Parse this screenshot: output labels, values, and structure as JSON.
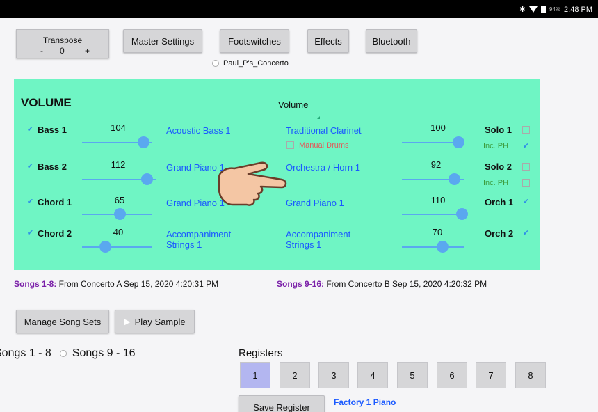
{
  "status_bar": {
    "battery": "94%",
    "time": "2:48 PM"
  },
  "top_buttons": {
    "transpose_label": "Transpose",
    "transpose_minus": "-",
    "transpose_value": "0",
    "transpose_plus": "+",
    "master_settings": "Master Settings",
    "footswitches": "Footswitches",
    "effects": "Effects",
    "bluetooth": "Bluetooth"
  },
  "song_name": "Paul_P's_Concerto",
  "volume_panel": {
    "title": "VOLUME",
    "center_label": "Volume",
    "left_rows": [
      {
        "label": "Bass 1",
        "value": "104",
        "voice": "Acoustic Bass 1",
        "checked": true,
        "level": 0.82
      },
      {
        "label": "Bass 2",
        "value": "112",
        "voice": "Grand Piano 1",
        "checked": true,
        "level": 0.88
      },
      {
        "label": "Chord 1",
        "value": "65",
        "voice": "Grand Piano 1",
        "checked": true,
        "level": 0.51
      },
      {
        "label": "Chord 2",
        "value": "40",
        "voice": "Accompaniment Strings 1",
        "checked": true,
        "level": 0.31
      }
    ],
    "right_rows": [
      {
        "voice": "Traditional Clarinet",
        "value": "100",
        "label": "Solo 1",
        "checked": false,
        "level": 0.79
      },
      {
        "voice": "Orchestra / Horn 1",
        "value": "92",
        "label": "Solo 2",
        "checked": false,
        "level": 0.72
      },
      {
        "voice": "Grand Piano 1",
        "value": "110",
        "label": "Orch 1",
        "checked": true,
        "level": 0.87
      },
      {
        "voice": "Accompaniment Strings 1",
        "value": "70",
        "label": "Orch 2",
        "checked": true,
        "level": 0.55
      }
    ],
    "manual_drums": "Manual Drums",
    "inc_ph": "Inc. PH"
  },
  "songs_info": {
    "set1_label": "Songs 1-8:",
    "set1_text": " From Concerto A Sep 15, 2020 4:20:31 PM",
    "set2_label": "Songs 9-16:",
    "set2_text": " From Concerto B Sep 15, 2020 4:20:32 PM"
  },
  "actions": {
    "manage_song_sets": "Manage Song Sets",
    "play_sample": "Play Sample"
  },
  "song_switch": {
    "left": "Songs 1 - 8",
    "right": "Songs 9 - 16"
  },
  "registers": {
    "label": "Registers",
    "items": [
      "1",
      "2",
      "3",
      "4",
      "5",
      "6",
      "7",
      "8"
    ],
    "selected": "1",
    "save_label": "Save Register",
    "current_name": "Factory 1 Piano"
  },
  "colors": {
    "panel_bg": "#6ff5c4",
    "voice_blue": "#1a59ff",
    "slider_blue": "#5aa8ef",
    "songs_label_purple": "#7a1fa8",
    "manual_red": "#e25b5b"
  },
  "icons": [
    "bluetooth-icon",
    "wifi-icon",
    "battery-icon",
    "radio-icon",
    "check-icon",
    "play-icon",
    "hand-pointer-icon"
  ]
}
